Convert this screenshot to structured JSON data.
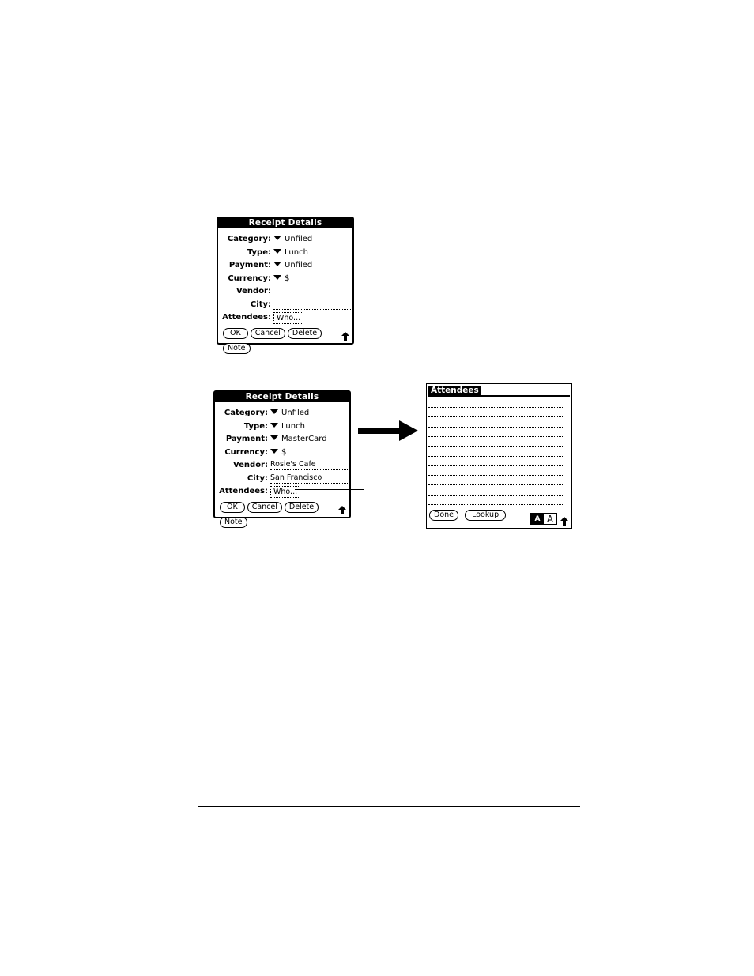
{
  "screen_top": {
    "title": "Receipt Details",
    "fields": [
      {
        "label": "Category:",
        "kind": "picker",
        "value": "Unfiled"
      },
      {
        "label": "Type:",
        "kind": "picker",
        "value": "Lunch"
      },
      {
        "label": "Payment:",
        "kind": "picker",
        "value": "Unfiled"
      },
      {
        "label": "Currency:",
        "kind": "picker",
        "value": "$"
      },
      {
        "label": "Vendor:",
        "kind": "text",
        "value": ""
      },
      {
        "label": "City:",
        "kind": "text",
        "value": ""
      },
      {
        "label": "Attendees:",
        "kind": "button",
        "value": "Who..."
      }
    ],
    "buttons": [
      "OK",
      "Cancel",
      "Delete",
      "Note"
    ]
  },
  "screen_bottom": {
    "title": "Receipt Details",
    "fields": [
      {
        "label": "Category:",
        "kind": "picker",
        "value": "Unfiled"
      },
      {
        "label": "Type:",
        "kind": "picker",
        "value": "Lunch"
      },
      {
        "label": "Payment:",
        "kind": "picker",
        "value": "MasterCard"
      },
      {
        "label": "Currency:",
        "kind": "picker",
        "value": "$"
      },
      {
        "label": "Vendor:",
        "kind": "text",
        "value": "Rosie's Cafe"
      },
      {
        "label": "City:",
        "kind": "text",
        "value": "San Francisco"
      },
      {
        "label": "Attendees:",
        "kind": "button",
        "value": "Who..."
      }
    ],
    "buttons": [
      "OK",
      "Cancel",
      "Delete",
      "Note"
    ]
  },
  "attendees_screen": {
    "title": "Attendees",
    "line_count": 11,
    "buttons": [
      "Done",
      "Lookup"
    ],
    "font_small": "A",
    "font_large": "A"
  },
  "icons": {
    "picker": "dropdown-triangle-icon",
    "scroll": "up-arrow-icon",
    "flow": "right-arrow-icon"
  }
}
